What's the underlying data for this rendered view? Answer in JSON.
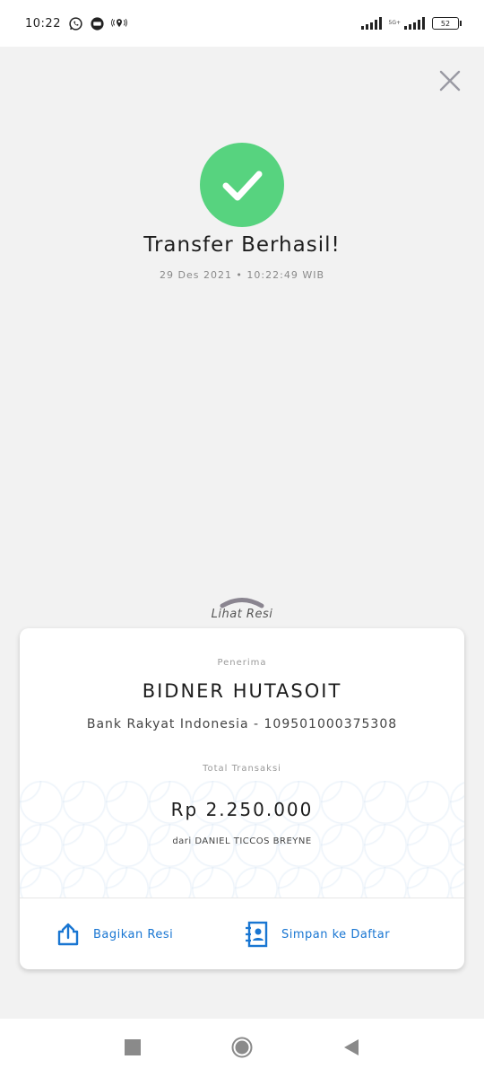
{
  "status_bar": {
    "time": "10:22",
    "net_label": "5G+",
    "battery": "52"
  },
  "header": {
    "title": "Transfer Berhasil!",
    "timestamp": "29 Des 2021 • 10:22:49 WIB"
  },
  "receipt": {
    "toggle_label": "Lihat Resi",
    "recipient_label": "Penerima",
    "recipient_name": "BIDNER HUTASOIT",
    "recipient_bank": "Bank Rakyat Indonesia - 109501000375308",
    "total_label": "Total Transaksi",
    "amount": "Rp 2.250.000",
    "from": "dari DANIEL TICCOS BREYNE"
  },
  "actions": {
    "share_label": "Bagikan Resi",
    "save_label": "Simpan ke Daftar"
  },
  "colors": {
    "success": "#57d37f",
    "accent": "#1976d2",
    "background": "#f2f2f2"
  },
  "icons": [
    "whatsapp-icon",
    "notification-icon",
    "location-icon",
    "signal-icon",
    "battery-icon",
    "close-icon",
    "checkmark-icon",
    "share-icon",
    "contact-book-icon",
    "recent-apps-icon",
    "home-icon",
    "back-icon"
  ]
}
